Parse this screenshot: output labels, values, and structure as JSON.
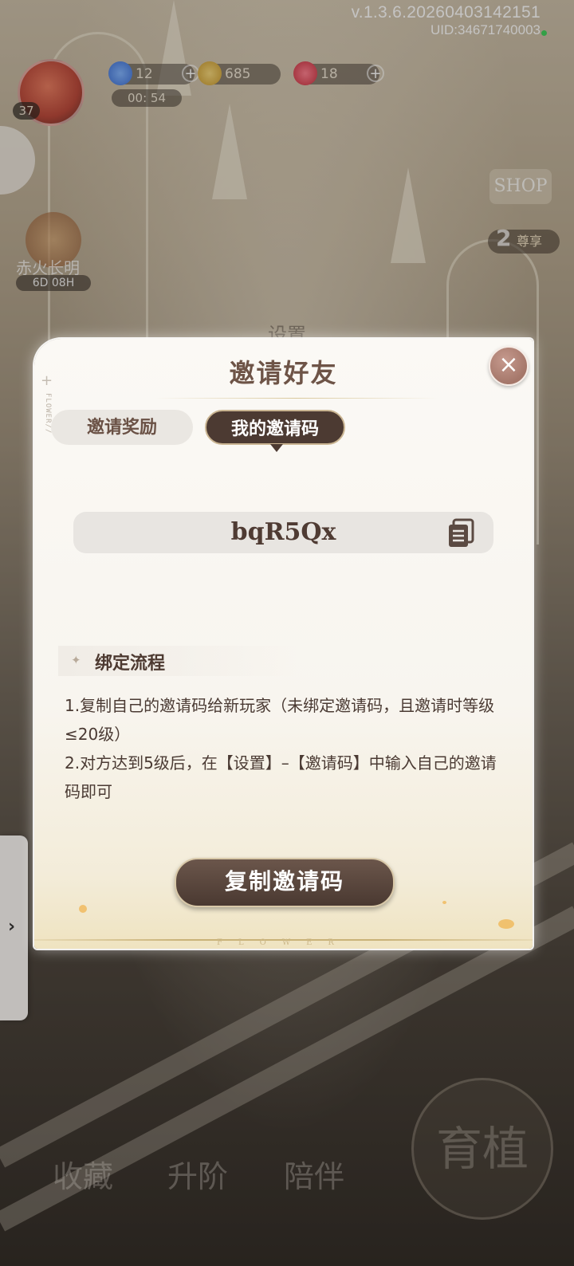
{
  "hud": {
    "version": "v.1.3.6.20260403142151",
    "uid": "UID:34671740003",
    "level": "37",
    "energy": "12",
    "gold": "685",
    "gems": "18",
    "timer": "00: 54",
    "event_name": "赤火长明",
    "event_time": "6D 08H",
    "shop_label": "SHOP",
    "vip_count": "2",
    "vip_label": "尊享",
    "settings_title": "设置"
  },
  "drawer": {
    "arrow": "›"
  },
  "bottom_nav": [
    {
      "label": "收藏"
    },
    {
      "label": "升阶"
    },
    {
      "label": "陪伴"
    }
  ],
  "grow_button": {
    "label": "育植"
  },
  "dialog": {
    "title": "邀请好友",
    "close": "×",
    "tabs": [
      {
        "label": "邀请奖励",
        "active": false
      },
      {
        "label": "我的邀请码",
        "active": true
      }
    ],
    "invite_code": "bqR5Qx",
    "section_title": "绑定流程",
    "steps": [
      "1.复制自己的邀请码给新玩家（未绑定邀请码，且邀请时等级≤20级）",
      " 2.对方达到5级后，在【设置】–【邀请码】中输入自己的邀请码即可"
    ],
    "copy_button": "复制邀请码",
    "side_deco": "FLOWER//",
    "bottom_deco": "FLOWER"
  },
  "colors": {
    "accent_dark": "#4c3a32",
    "title_brown": "#6e5447",
    "gold_line": "#c9b278",
    "close_button": "#a5776a"
  }
}
